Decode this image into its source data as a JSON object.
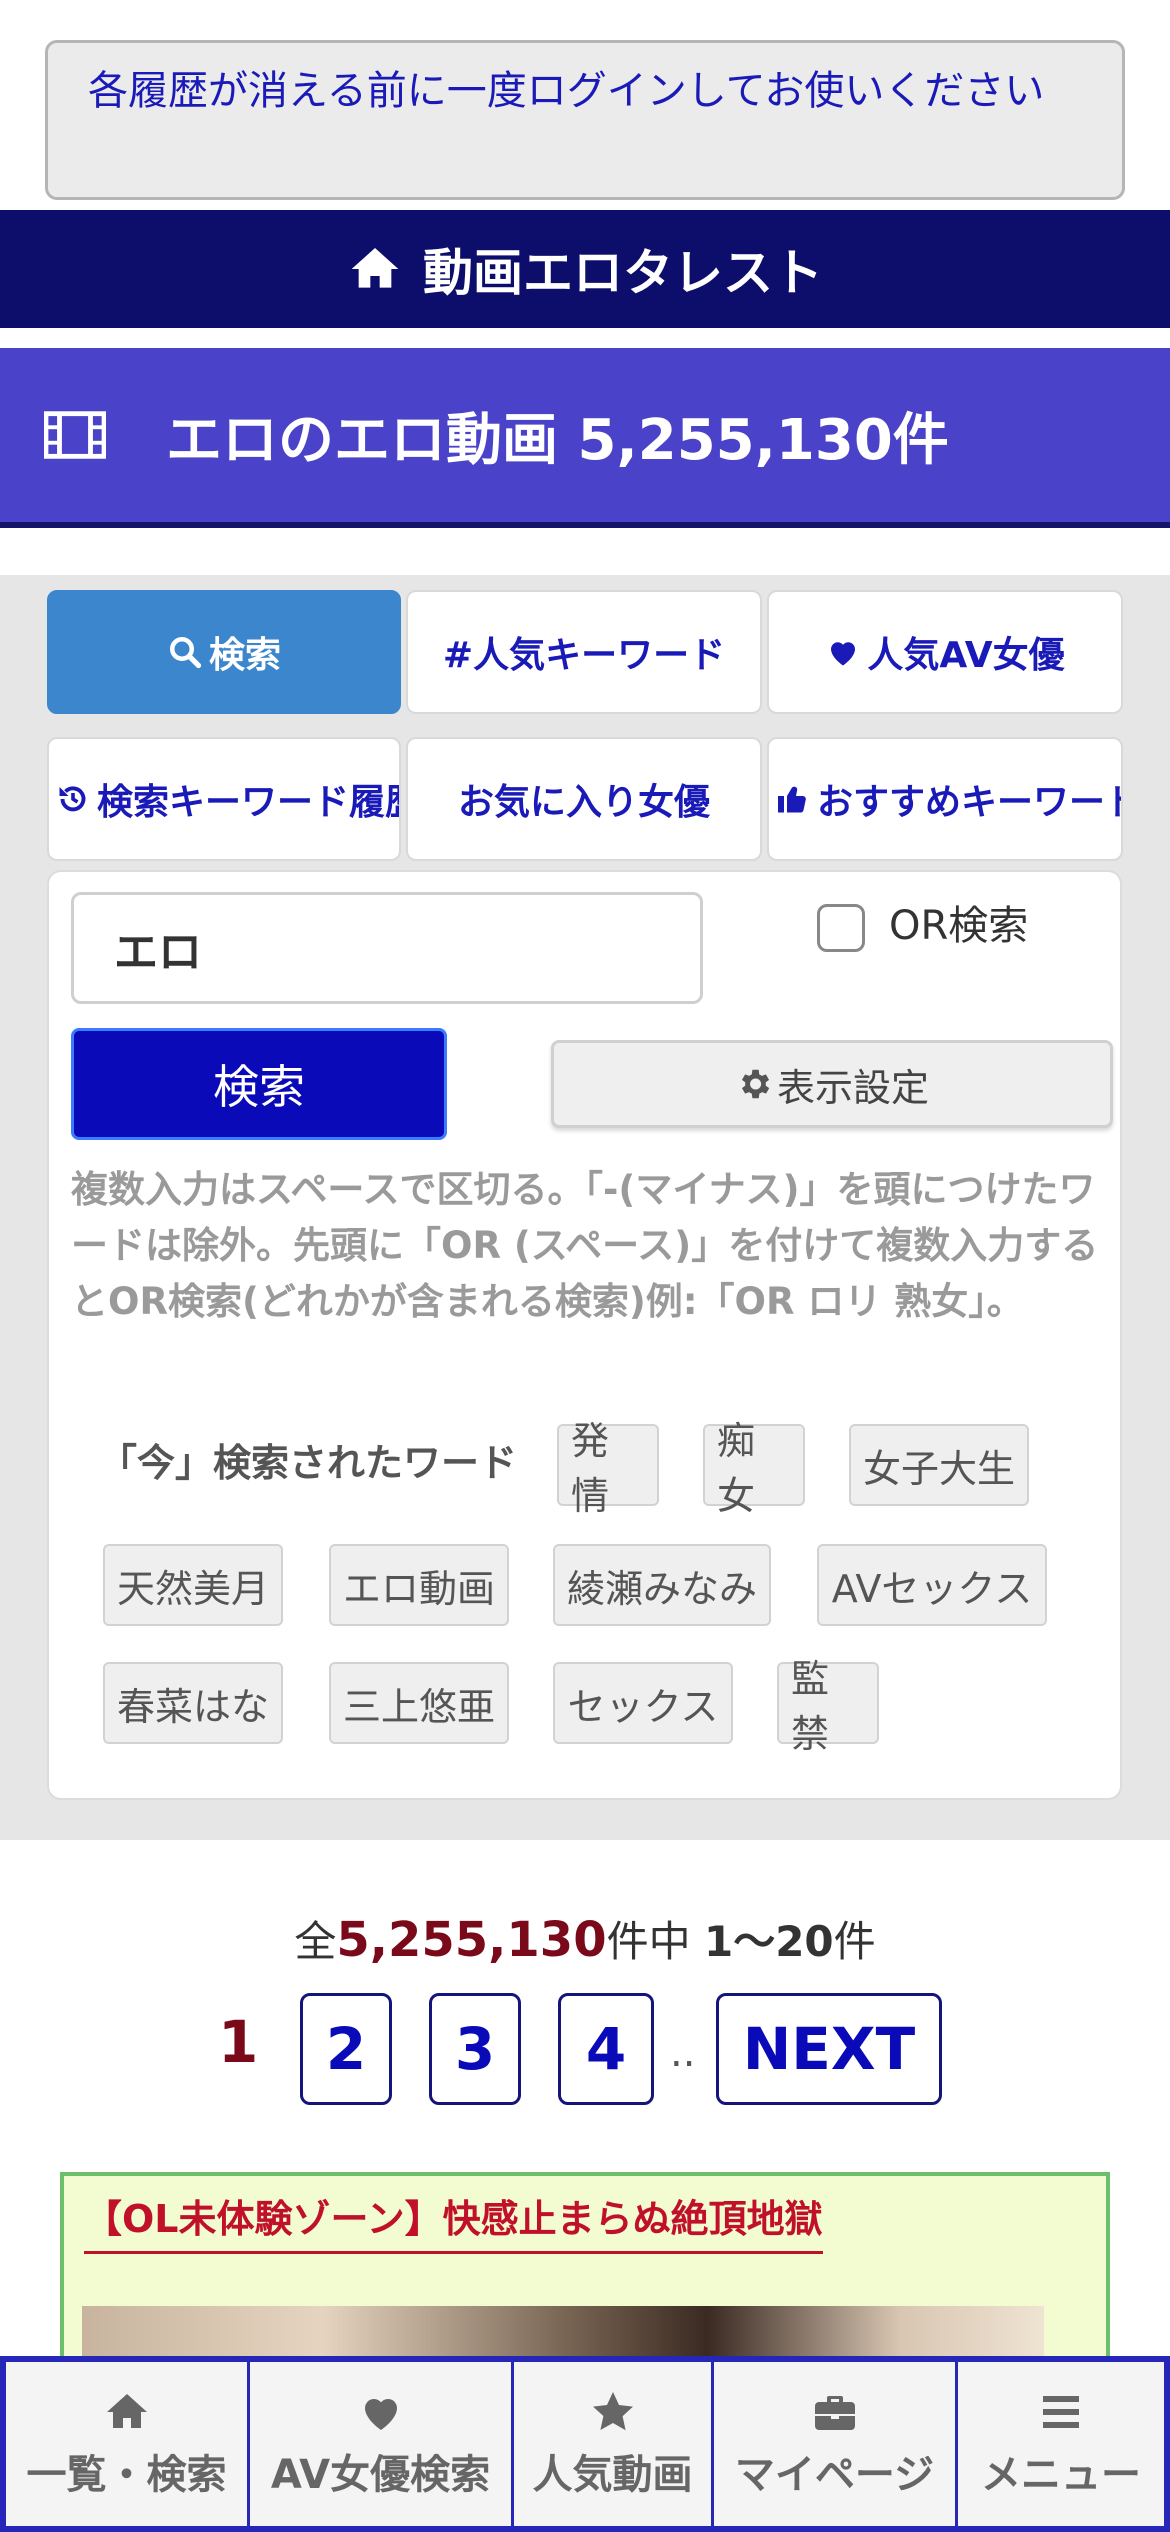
{
  "notice": {
    "text": "各履歴が消える前に一度ログインしてお使いください"
  },
  "site": {
    "title": "動画エロタレスト",
    "icon": "home-icon"
  },
  "page": {
    "title": "エロのエロ動画 5,255,130件",
    "icon": "film-icon"
  },
  "tabs": [
    {
      "label": "検索",
      "icon": "search-icon",
      "active": true
    },
    {
      "label": "#人気キーワード",
      "icon": "",
      "active": false
    },
    {
      "label": "人気AV女優",
      "icon": "heart-icon",
      "active": false
    },
    {
      "label": "検索キーワード履歴",
      "icon": "history-icon",
      "active": false
    },
    {
      "label": "お気に入り女優",
      "icon": "",
      "active": false
    },
    {
      "label": "おすすめキーワード",
      "icon": "thumbs-up-icon",
      "active": false
    }
  ],
  "search": {
    "value": "エロ",
    "or_label": "OR検索",
    "button_label": "検索",
    "display_settings_label": "表示設定",
    "help": "複数入力はスペースで区切る。「-(マイナス)」を頭につけたワードは除外。先頭に「OR (スペース)」を付けて複数入力するとOR検索(どれかが含まれる検索)例:「OR ロリ 熟女」。"
  },
  "now_keywords": {
    "title": "「今」検索されたワード",
    "items": [
      "発情",
      "痴女",
      "女子大生",
      "天然美月",
      "エロ動画",
      "綾瀬みなみ",
      "AVセックス",
      "春菜はな",
      "三上悠亜",
      "セックス",
      "監禁"
    ]
  },
  "results": {
    "prefix": "全",
    "total": "5,255,130",
    "mid": "件中 ",
    "range": "1〜20",
    "suffix": "件"
  },
  "pagination": {
    "current": "1",
    "pages": [
      "2",
      "3",
      "4"
    ],
    "dots": "..",
    "next": "NEXT"
  },
  "video": {
    "title": "【OL未体験ゾーン】快感止まらぬ絶頂地獄"
  },
  "bottom_nav": [
    {
      "label": "一覧・検索",
      "icon": "home-icon"
    },
    {
      "label": "AV女優検索",
      "icon": "heart-icon"
    },
    {
      "label": "人気動画",
      "icon": "star-icon"
    },
    {
      "label": "マイページ",
      "icon": "briefcase-icon"
    },
    {
      "label": "メニュー",
      "icon": "menu-icon"
    }
  ],
  "colors": {
    "navy": "#0d0d6b",
    "purple": "#4a42c8",
    "active_tab": "#3b86cc",
    "primary_button": "#0a0ab8",
    "accent_red": "#7a0a1a"
  }
}
